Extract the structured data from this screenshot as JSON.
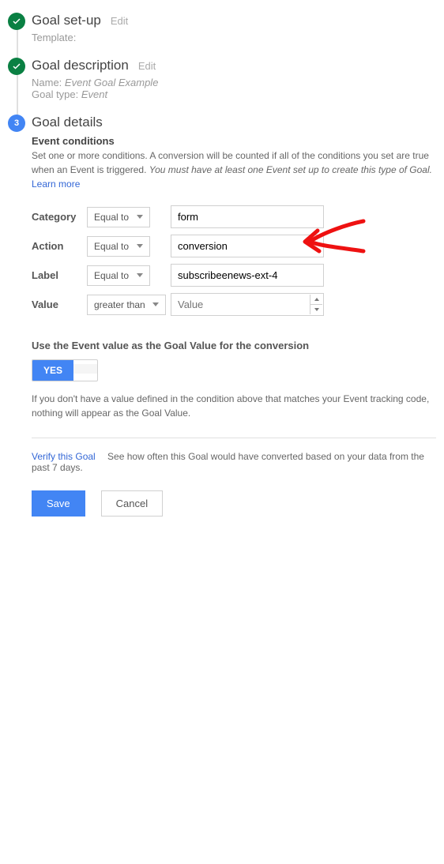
{
  "steps": {
    "setup": {
      "title": "Goal set-up",
      "edit": "Edit",
      "template_label": "Template:"
    },
    "desc": {
      "title": "Goal description",
      "edit": "Edit",
      "name_label": "Name:",
      "name_value": "Event Goal Example",
      "type_label": "Goal type:",
      "type_value": "Event"
    },
    "details": {
      "number": "3",
      "title": "Goal details"
    }
  },
  "conditions": {
    "heading": "Event conditions",
    "help_pre": "Set one or more conditions. A conversion will be counted if all of the conditions you set are true when an Event is triggered. ",
    "help_em": "You must have at least one Event set up to create this type of Goal.",
    "learn": "Learn more",
    "rows": {
      "category": {
        "label": "Category",
        "op": "Equal to",
        "value": "form"
      },
      "action": {
        "label": "Action",
        "op": "Equal to",
        "value": "conversion"
      },
      "label": {
        "label": "Label",
        "op": "Equal to",
        "value": "subscribeenews-ext-4"
      },
      "value": {
        "label": "Value",
        "op": "greater than",
        "placeholder": "Value"
      }
    }
  },
  "goalvalue": {
    "heading": "Use the Event value as the Goal Value for the conversion",
    "yes": "YES",
    "hint": "If you don't have a value defined in the condition above that matches your Event tracking code, nothing will appear as the Goal Value."
  },
  "verify": {
    "link": "Verify this Goal",
    "text": "See how often this Goal would have converted based on your data from the past 7 days."
  },
  "buttons": {
    "save": "Save",
    "cancel": "Cancel"
  }
}
